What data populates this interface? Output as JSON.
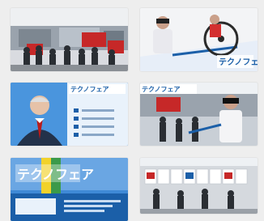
{
  "thumbnails": [
    {
      "id": "thumb-1",
      "scene": "exhibition-hall-crowd"
    },
    {
      "id": "thumb-2",
      "scene": "vr-wheelchair-promo",
      "logo_text": "テクノフェア"
    },
    {
      "id": "thumb-3",
      "scene": "presenter-portrait",
      "logo_text": "テクノフェア"
    },
    {
      "id": "thumb-4",
      "scene": "vr-booth-visitors",
      "logo_text": "テクノフェア"
    },
    {
      "id": "thumb-5",
      "scene": "fair-poster",
      "logo_text": "テクノフェア"
    },
    {
      "id": "thumb-6",
      "scene": "booth-display"
    }
  ],
  "colors": {
    "background": "#eeeeee",
    "brand_blue": "#1b5fa8",
    "accent_yellow": "#f2d22a",
    "accent_green": "#3b9a4a",
    "hall_red": "#c62828"
  }
}
